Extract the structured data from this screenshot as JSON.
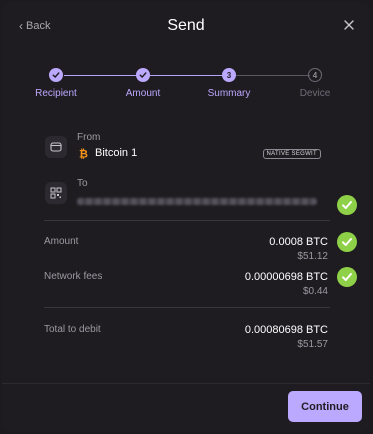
{
  "header": {
    "back_label": "Back",
    "title": "Send"
  },
  "stepper": {
    "steps": [
      {
        "label": "Recipient",
        "state": "done",
        "number": ""
      },
      {
        "label": "Amount",
        "state": "done",
        "number": ""
      },
      {
        "label": "Summary",
        "state": "current",
        "number": "3"
      },
      {
        "label": "Device",
        "state": "future",
        "number": "4"
      }
    ]
  },
  "from": {
    "label": "From",
    "account_name": "Bitcoin 1",
    "badge": "NATIVE SEGWIT"
  },
  "to": {
    "label": "To"
  },
  "amount": {
    "label": "Amount",
    "crypto": "0.0008 BTC",
    "fiat": "$51.12"
  },
  "fees": {
    "label": "Network fees",
    "crypto": "0.00000698 BTC",
    "fiat": "$0.44"
  },
  "total": {
    "label": "Total to debit",
    "crypto": "0.00080698 BTC",
    "fiat": "$51.57"
  },
  "footer": {
    "continue_label": "Continue"
  },
  "colors": {
    "accent": "#bba9ff",
    "check": "#8ed047",
    "bitcoin": "#f7931a",
    "background": "#1e1c21"
  }
}
